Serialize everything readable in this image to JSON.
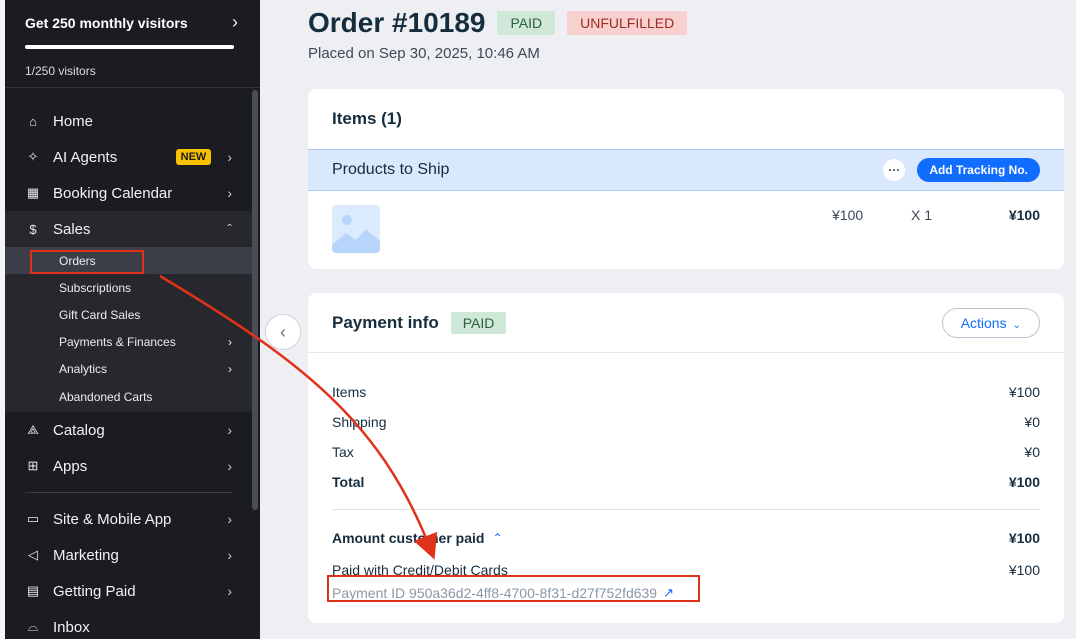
{
  "sidebar": {
    "visitors_title": "Get 250 monthly visitors",
    "visitors_count": "1/250 visitors",
    "visitors_progress": 0.004,
    "items": [
      {
        "label": "Home",
        "icon": "home-icon"
      },
      {
        "label": "AI Agents",
        "icon": "sparkle-icon",
        "badge": "NEW"
      },
      {
        "label": "Booking Calendar",
        "icon": "calendar-icon"
      },
      {
        "label": "Sales",
        "icon": "dollar-icon"
      }
    ],
    "sales_sub": [
      {
        "label": "Orders"
      },
      {
        "label": "Subscriptions"
      },
      {
        "label": "Gift Card Sales"
      },
      {
        "label": "Payments & Finances"
      },
      {
        "label": "Analytics"
      },
      {
        "label": "Abandoned Carts"
      }
    ],
    "items2": [
      {
        "label": "Catalog",
        "icon": "catalog-icon"
      },
      {
        "label": "Apps",
        "icon": "apps-icon"
      }
    ],
    "items3": [
      {
        "label": "Site & Mobile App",
        "icon": "site-icon"
      },
      {
        "label": "Marketing",
        "icon": "megaphone-icon"
      },
      {
        "label": "Getting Paid",
        "icon": "document-icon"
      },
      {
        "label": "Inbox",
        "icon": "inbox-icon"
      }
    ]
  },
  "order": {
    "title": "Order #10189",
    "payment_status": "PAID",
    "fulfillment_status": "UNFULFILLED",
    "placed": "Placed on Sep 30, 2025, 10:46 AM"
  },
  "items_card": {
    "title": "Items (1)",
    "ship_label": "Products to Ship",
    "more_label": "···",
    "track_button": "Add Tracking No.",
    "product": {
      "price": "¥100",
      "qty": "X 1",
      "total": "¥100"
    }
  },
  "payment": {
    "title": "Payment info",
    "status": "PAID",
    "actions_label": "Actions",
    "rows": [
      {
        "label": "Items",
        "value": "¥100"
      },
      {
        "label": "Shipping",
        "value": "¥0"
      },
      {
        "label": "Tax",
        "value": "¥0"
      },
      {
        "label": "Total",
        "value": "¥100"
      }
    ],
    "amount_paid_label": "Amount customer paid",
    "amount_paid_value": "¥100",
    "method_label": "Paid with Credit/Debit Cards",
    "method_value": "¥100",
    "payment_id": "Payment ID 950a36d2-4ff8-4700-8f31-d27f752fd639"
  },
  "colors": {
    "accent": "#116dff",
    "annotation": "#e0321a",
    "sidebar_bg": "#1a1c22"
  }
}
